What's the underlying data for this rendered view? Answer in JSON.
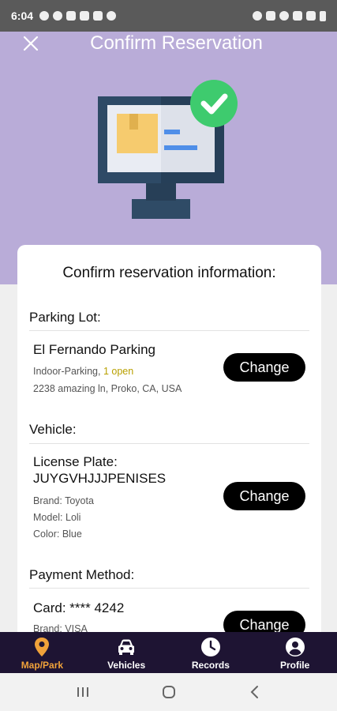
{
  "status_bar": {
    "time": "6:04"
  },
  "header": {
    "title": "Confirm Reservation"
  },
  "card": {
    "heading": "Confirm reservation information:",
    "parking": {
      "label": "Parking Lot:",
      "name": "El Fernando Parking",
      "type": "Indoor-Parking, ",
      "open": "1 open",
      "address": "2238 amazing ln, Proko, CA, USA",
      "change_label": "Change"
    },
    "vehicle": {
      "label": "Vehicle:",
      "plate_label": "License Plate:",
      "plate": "JUYGVHJJJPENISES",
      "brand": "Brand: Toyota",
      "model": "Model: Loli",
      "color": "Color: Blue",
      "change_label": "Change"
    },
    "payment": {
      "label": "Payment Method:",
      "card": "Card: **** 4242",
      "brand": "Brand: VISA",
      "change_label": "Change"
    }
  },
  "bottom_nav": {
    "items": [
      {
        "label": "Map/Park",
        "icon": "map-pin-icon",
        "active": true
      },
      {
        "label": "Vehicles",
        "icon": "car-icon",
        "active": false
      },
      {
        "label": "Records",
        "icon": "clock-icon",
        "active": false
      },
      {
        "label": "Profile",
        "icon": "person-icon",
        "active": false
      }
    ]
  },
  "colors": {
    "hero": "#b9acd8",
    "nav_background": "#1e1433",
    "nav_active": "#f0a23a",
    "open_text": "#b8a000",
    "check_badge": "#3ecb6e"
  }
}
